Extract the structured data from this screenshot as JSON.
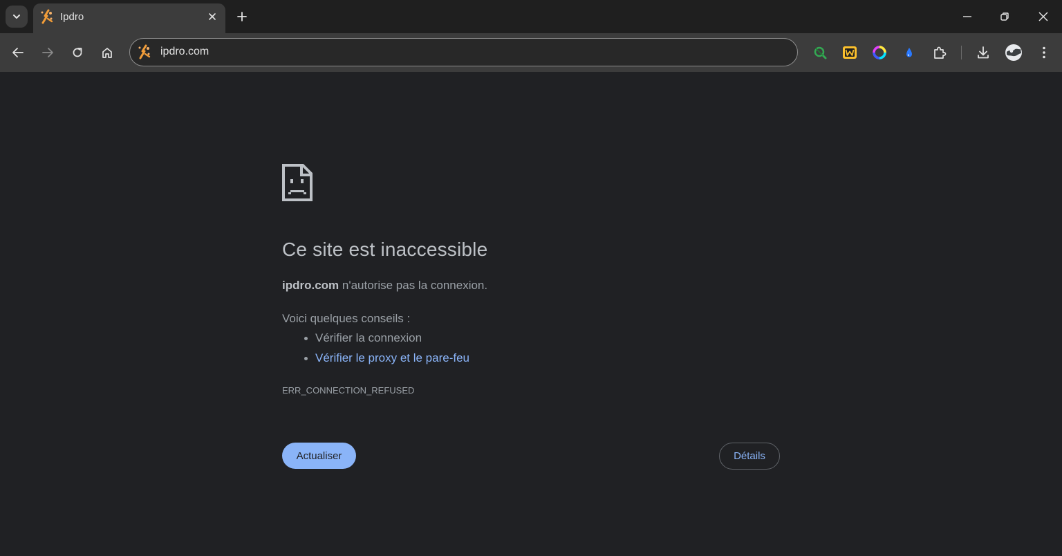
{
  "tab": {
    "title": "Ipdro",
    "favicon": "bolt-sparkle-icon"
  },
  "omnibox": {
    "url": "ipdro.com"
  },
  "toolbar": {
    "icons": [
      "back-icon",
      "forward-icon",
      "reload-icon",
      "home-icon"
    ],
    "extensions": [
      "magnifier-extension-icon",
      "w-extension-icon",
      "color-ring-extension-icon",
      "drop-extension-icon",
      "puzzle-extensions-icon"
    ],
    "right": [
      "download-icon",
      "profile-avatar-icon",
      "menu-kebab-icon"
    ]
  },
  "error_page": {
    "heading": "Ce site est inaccessible",
    "host": "ipdro.com",
    "desc_rest": " n'autorise pas la connexion.",
    "tips_intro": "Voici quelques conseils :",
    "tips": [
      "Vérifier la connexion",
      "Vérifier le proxy et le pare-feu"
    ],
    "error_code": "ERR_CONNECTION_REFUSED",
    "reload_label": "Actualiser",
    "details_label": "Détails"
  },
  "colors": {
    "background": "#202124",
    "link": "#8ab4f8",
    "primary_button": "#8ab4f8",
    "toolbar": "#3c3c3c",
    "tabstrip": "#1f1f1f"
  }
}
